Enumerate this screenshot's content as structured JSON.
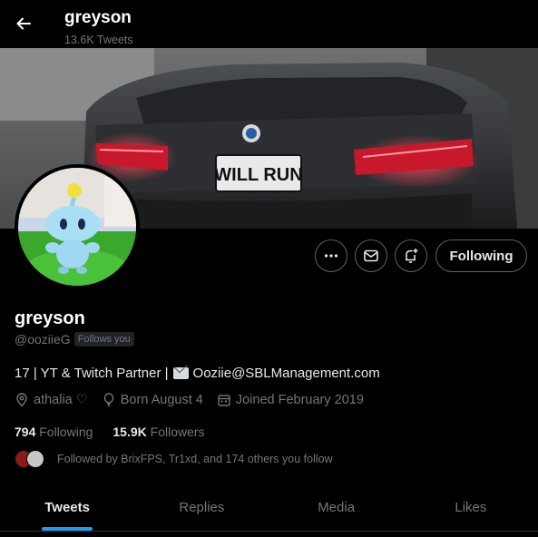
{
  "header": {
    "title": "greyson",
    "tweet_count": "13.6K Tweets"
  },
  "banner": {
    "plate_text": "WILL RUN"
  },
  "actions": {
    "follow_label": "Following"
  },
  "profile": {
    "display_name": "greyson",
    "handle": "@ooziieG",
    "follows_you": "Follows you",
    "bio_prefix": "17 | YT & Twitch Partner |",
    "bio_email": "Ooziie@SBLManagement.com",
    "location": "athalia ♡",
    "birthday": "Born August 4",
    "joined": "Joined February 2019"
  },
  "stats": {
    "following_count": "794",
    "following_label": "Following",
    "followers_count": "15.9K",
    "followers_label": "Followers"
  },
  "followed_by": "Followed by BrixFPS, Tr1xd, and 174 others you follow",
  "tabs": [
    {
      "label": "Tweets"
    },
    {
      "label": "Replies"
    },
    {
      "label": "Media"
    },
    {
      "label": "Likes"
    }
  ],
  "colors": {
    "background": "#000000",
    "accent": "#1d9bf0",
    "muted": "#71767b"
  },
  "icons": [
    "back-arrow-icon",
    "more-icon",
    "mail-icon",
    "notification-plus-icon",
    "location-icon",
    "balloon-icon",
    "calendar-icon"
  ]
}
